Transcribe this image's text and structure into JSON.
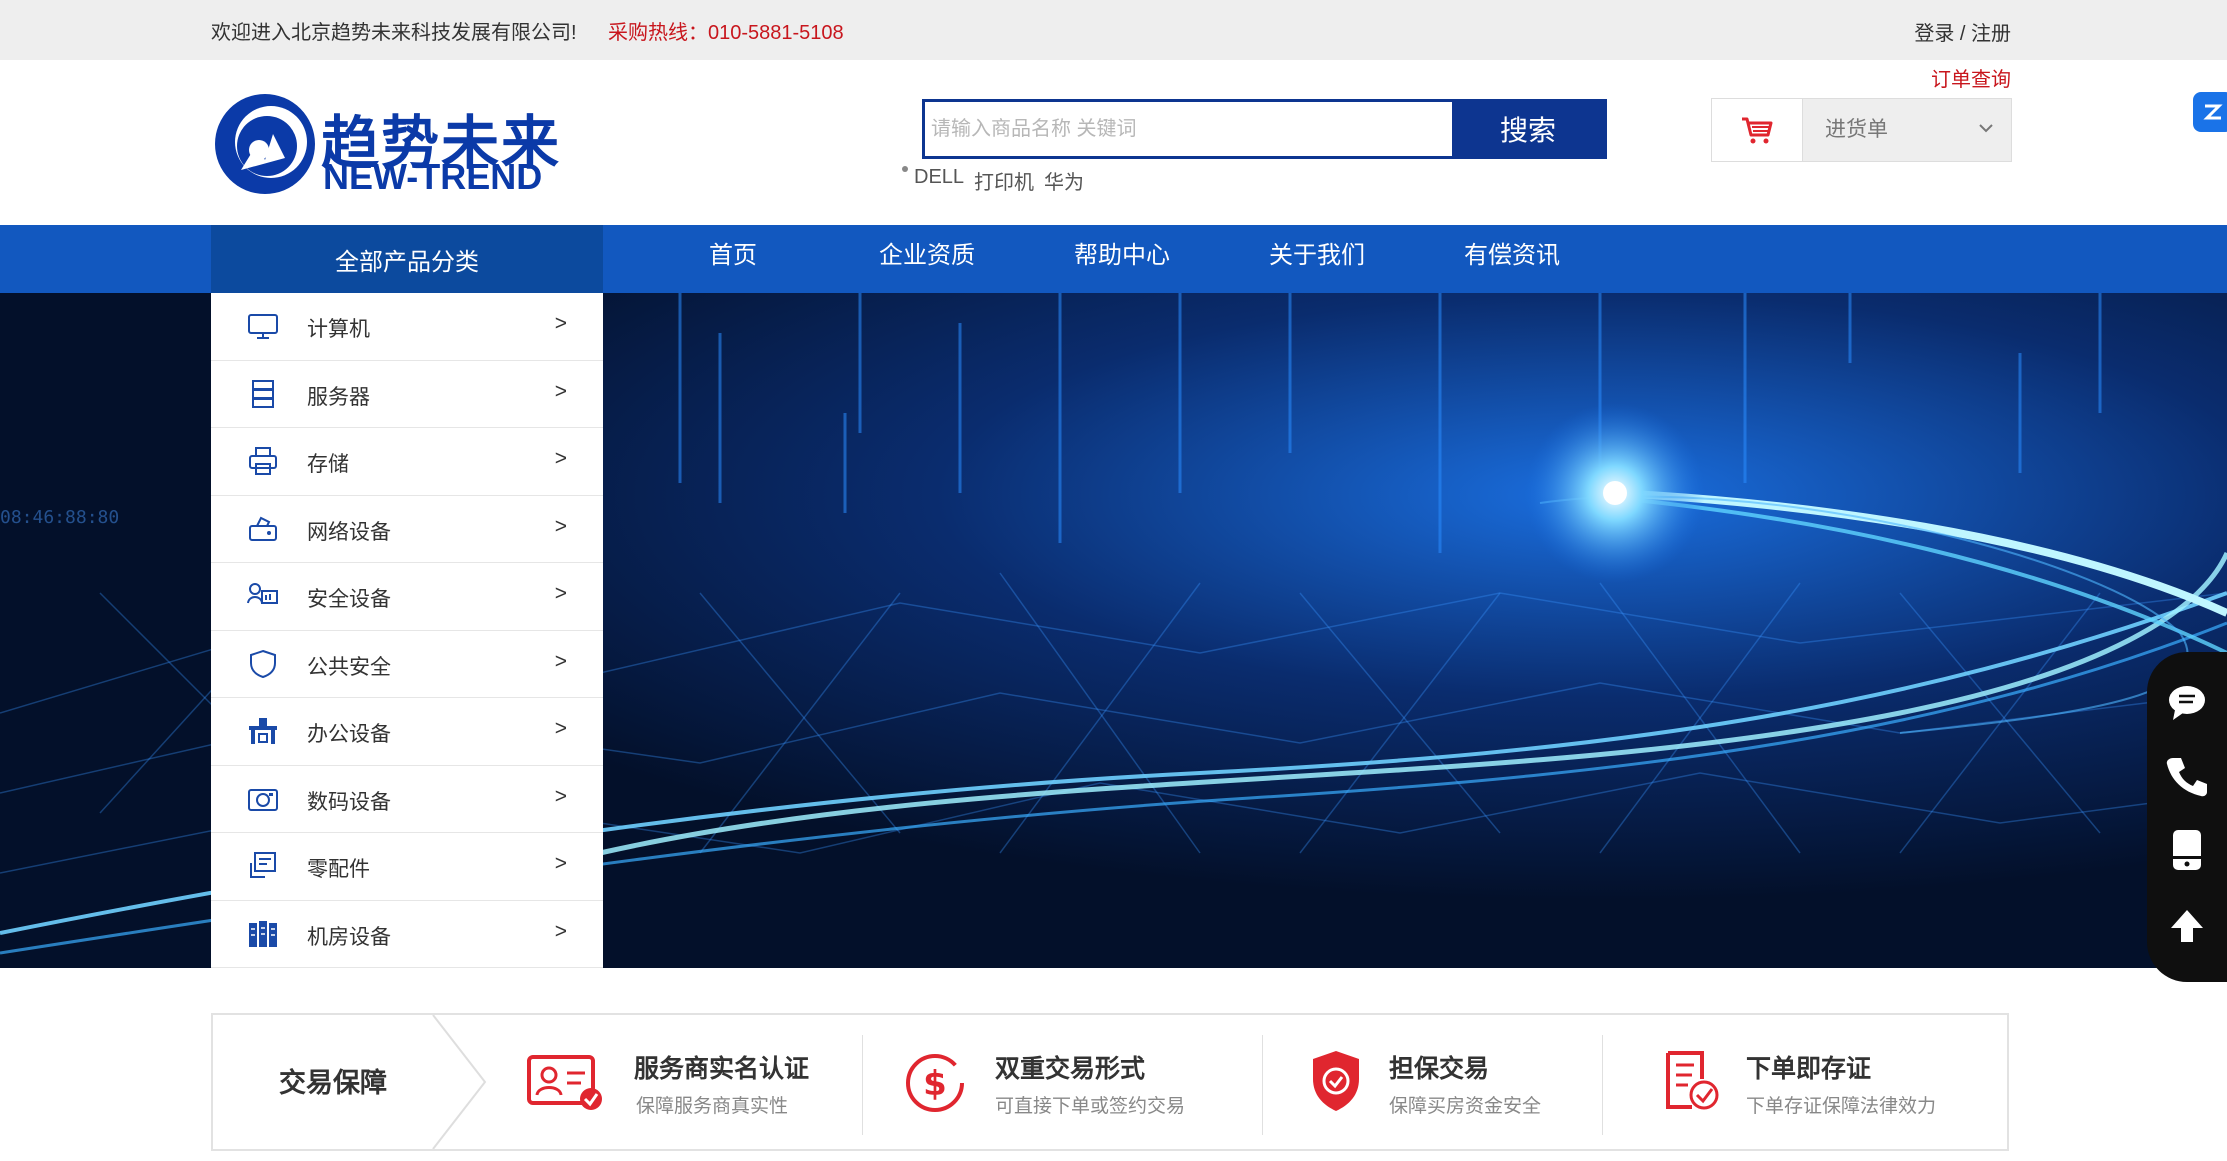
{
  "topbar": {
    "welcome": "欢迎进入北京趋势未来科技发展有限公司!",
    "hotline": "采购热线：010-5881-5108",
    "login": "登录 / 注册",
    "order_query": "订单查询"
  },
  "logo": {
    "cn": "趋势未来",
    "en": "NEW-TREND"
  },
  "search": {
    "placeholder": "请输入商品名称 关键词",
    "button": "搜索",
    "hot_words": [
      "DELL",
      "打印机",
      "华为"
    ]
  },
  "cart": {
    "label": "进货单",
    "icon": "cart-icon"
  },
  "nav": {
    "all_categories": "全部产品分类",
    "items": [
      "首页",
      "企业资质",
      "帮助中心",
      "关于我们",
      "有偿资讯"
    ]
  },
  "categories": [
    {
      "name": "计算机",
      "icon": "monitor-icon",
      "arrow": ">"
    },
    {
      "name": "服务器",
      "icon": "server-icon",
      "arrow": ">"
    },
    {
      "name": "存储",
      "icon": "printer-icon",
      "arrow": ">"
    },
    {
      "name": "网络设备",
      "icon": "network-icon",
      "arrow": ">"
    },
    {
      "name": "安全设备",
      "icon": "security-device-icon",
      "arrow": ">"
    },
    {
      "name": "公共安全",
      "icon": "shield-icon",
      "arrow": ">"
    },
    {
      "name": "办公设备",
      "icon": "office-icon",
      "arrow": ">"
    },
    {
      "name": "数码设备",
      "icon": "camera-icon",
      "arrow": ">"
    },
    {
      "name": "零配件",
      "icon": "parts-icon",
      "arrow": ">"
    },
    {
      "name": "机房设备",
      "icon": "rack-icon",
      "arrow": ">"
    }
  ],
  "carousel": {
    "slides": 2,
    "active": 1
  },
  "sidebar_tools": [
    "chat-icon",
    "phone-icon",
    "mobile-icon",
    "back-to-top-icon"
  ],
  "guarantee": {
    "title": "交易保障",
    "items": [
      {
        "title": "服务商实名认证",
        "sub": "保障服务商真实性",
        "icon": "id-card-icon"
      },
      {
        "title": "双重交易形式",
        "sub": "可直接下单或签约交易",
        "icon": "dollar-icon"
      },
      {
        "title": "担保交易",
        "sub": "保障买房资金安全",
        "icon": "shield-check-icon"
      },
      {
        "title": "下单即存证",
        "sub": "下单存证保障法律效力",
        "icon": "document-check-icon"
      }
    ]
  },
  "colors": {
    "brand": "#0b3aa8",
    "nav": "#1258bf",
    "nav_dark": "#0c4a9e",
    "accent_red": "#c8161d",
    "icon_red": "#e0262f"
  }
}
